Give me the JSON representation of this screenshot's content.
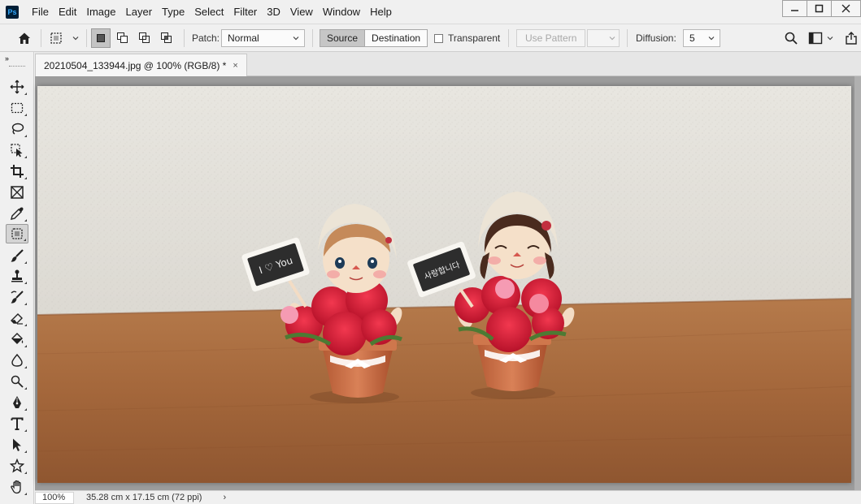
{
  "app": {
    "logo_text": "Ps"
  },
  "menu": [
    "File",
    "Edit",
    "Image",
    "Layer",
    "Type",
    "Select",
    "Filter",
    "3D",
    "View",
    "Window",
    "Help"
  ],
  "options": {
    "patch_label": "Patch:",
    "patch_value": "Normal",
    "source_label": "Source",
    "destination_label": "Destination",
    "transparent_label": "Transparent",
    "transparent_checked": false,
    "use_pattern_label": "Use Pattern",
    "diffusion_label": "Diffusion:",
    "diffusion_value": "5"
  },
  "document": {
    "tab_title": "20210504_133944.jpg @ 100% (RGB/8) *",
    "close_glyph": "×"
  },
  "photo": {
    "sign_left": "I ♡ You",
    "sign_right": "사랑합니다"
  },
  "status": {
    "zoom": "100%",
    "doc_info": "35.28 cm x 17.15 cm (72 ppi)",
    "arrow": "›"
  },
  "colors": {
    "accent": "#31a8ff",
    "app_logo_bg": "#001e36",
    "canvas_bg": "#9c9c9c",
    "wall": "#ece9e2",
    "table": "#a8663a"
  },
  "tools": [
    "move-tool",
    "marquee-tool",
    "lasso-tool",
    "object-selection-tool",
    "crop-tool",
    "frame-tool",
    "eyedropper-tool",
    "patch-tool",
    "brush-tool",
    "stamp-tool",
    "history-brush-tool",
    "eraser-tool",
    "paint-bucket-tool",
    "blur-tool",
    "dodge-tool",
    "pen-tool",
    "type-tool",
    "path-selection-tool",
    "shape-tool",
    "hand-tool"
  ]
}
